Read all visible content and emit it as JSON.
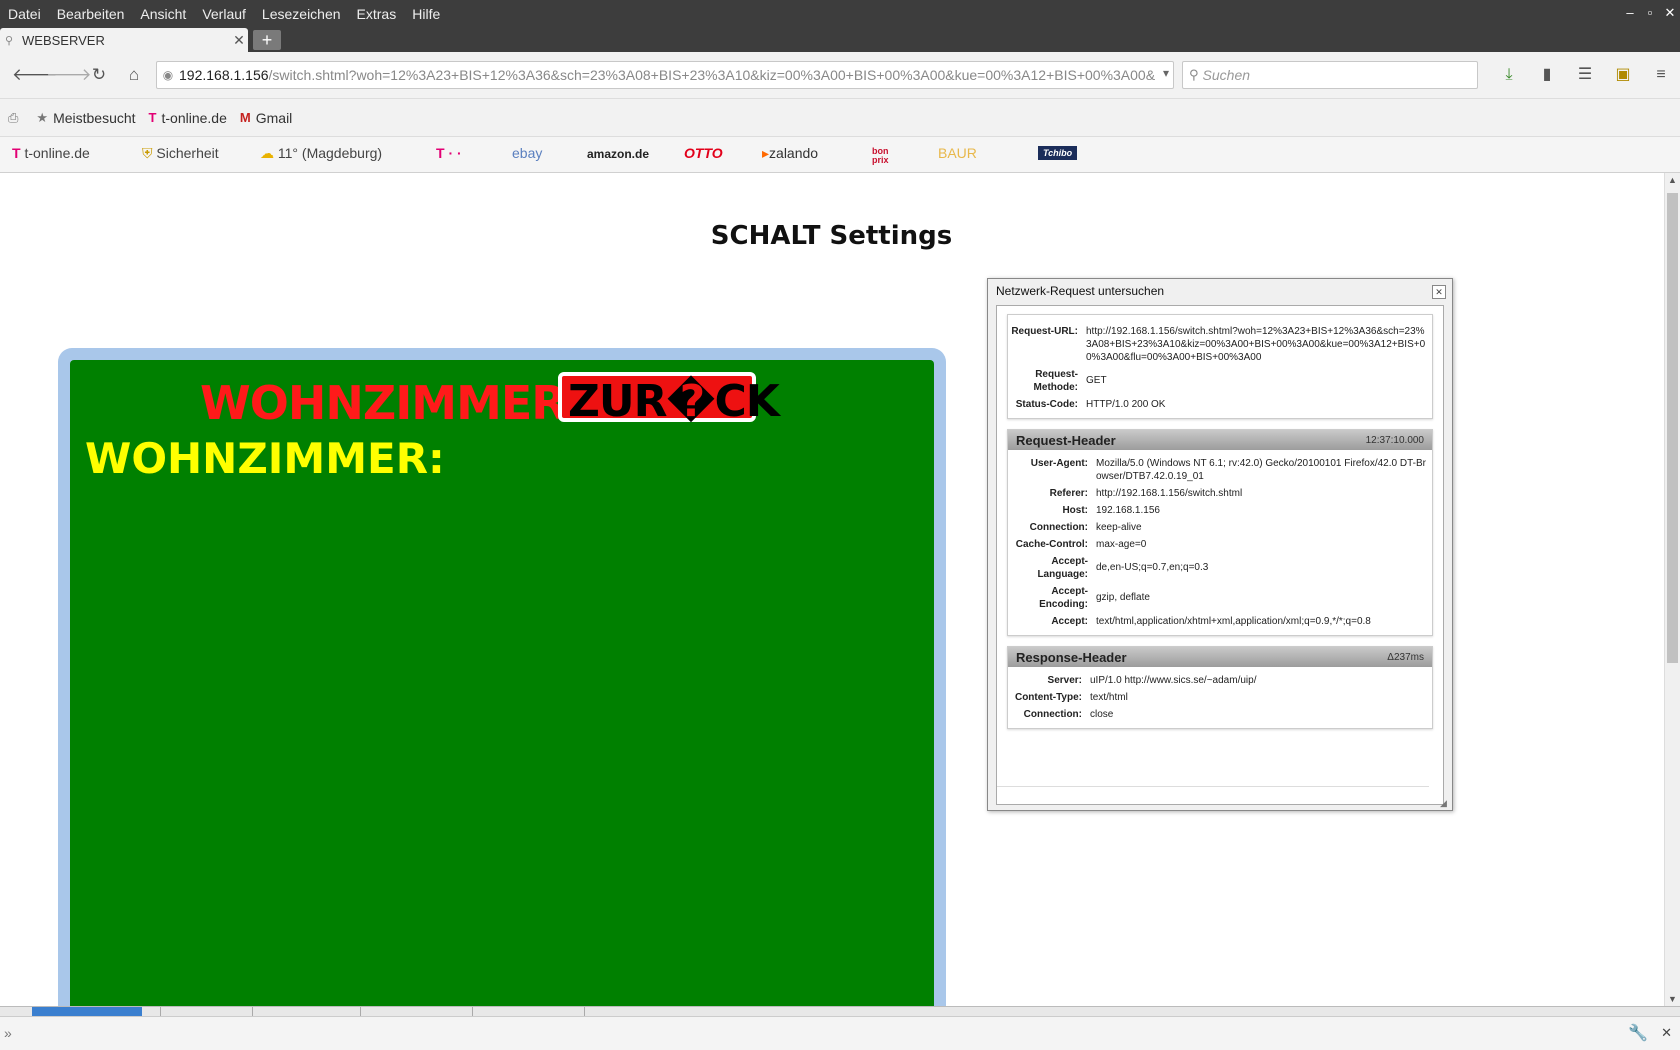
{
  "menu": [
    "Datei",
    "Bearbeiten",
    "Ansicht",
    "Verlauf",
    "Lesezeichen",
    "Extras",
    "Hilfe"
  ],
  "window_controls": {
    "minimize": "–",
    "maximize": "▫",
    "close": "✕"
  },
  "tab": {
    "title": "WEBSERVER",
    "close": "✕",
    "new_tab": "+"
  },
  "nav": {
    "back": "🡐",
    "forward": "🡒",
    "reload": "↻",
    "home": "⌂",
    "url_host": "192.168.1.156",
    "url_path": "/switch.shtml?woh=12%3A23+BIS+12%3A36&sch=23%3A08+BIS+23%3A10&kiz=00%3A00+BIS+00%3A00&kue=00%3A12+BIS+00%3A00&",
    "url_dropdown": "▾",
    "search_placeholder": "Suchen"
  },
  "bookmarks": [
    {
      "icon": "print-icon",
      "glyph": "⎙",
      "label": ""
    },
    {
      "icon": "most-visited-icon",
      "glyph": "★",
      "label": "Meistbesucht"
    },
    {
      "icon": "t-online-icon",
      "glyph": "T",
      "label": "t-online.de"
    },
    {
      "icon": "gmail-icon",
      "glyph": "M",
      "label": "Gmail"
    }
  ],
  "t_toolbar": {
    "home": "t-online.de",
    "security": "Sicherheit",
    "weather": "11° (Magdeburg)",
    "telekom": "T · ·",
    "ebay": "ebay",
    "amazon": "amazon.de",
    "otto": "OTTO",
    "zalando": "zalando",
    "bonprix": "bon prix",
    "baur": "BAUR",
    "tchibo": "Tchibo"
  },
  "page": {
    "title": "SCHALT Settings",
    "room_header": "WOHNZIMMER",
    "back_button": "ZUR�CK",
    "room_label": "WOHNZIMMER:"
  },
  "inspector": {
    "title": "Netzwerk-Request untersuchen",
    "close": "✕",
    "general": [
      {
        "key": "Request-URL:",
        "value": "http://192.168.1.156/switch.shtml?woh=12%3A23+BIS+12%3A36&sch=23%3A08+BIS+23%3A10&kiz=00%3A00+BIS+00%3A00&kue=00%3A12+BIS+00%3A00&flu=00%3A00+BIS+00%3A00"
      },
      {
        "key": "Request-Methode:",
        "value": "GET"
      },
      {
        "key": "Status-Code:",
        "value": "HTTP/1.0 200 OK"
      }
    ],
    "request_header": {
      "title": "Request-Header",
      "meta": "12:37:10.000",
      "rows": [
        {
          "key": "User-Agent:",
          "value": "Mozilla/5.0 (Windows NT 6.1; rv:42.0) Gecko/20100101 Firefox/42.0 DT-Browser/DTB7.42.0.19_01"
        },
        {
          "key": "Referer:",
          "value": "http://192.168.1.156/switch.shtml"
        },
        {
          "key": "Host:",
          "value": "192.168.1.156"
        },
        {
          "key": "Connection:",
          "value": "keep-alive"
        },
        {
          "key": "Cache-Control:",
          "value": "max-age=0"
        },
        {
          "key": "Accept-Language:",
          "value": "de,en-US;q=0.7,en;q=0.3"
        },
        {
          "key": "Accept-Encoding:",
          "value": "gzip, deflate"
        },
        {
          "key": "Accept:",
          "value": "text/html,application/xhtml+xml,application/xml;q=0.9,*/*;q=0.8"
        }
      ]
    },
    "response_header": {
      "title": "Response-Header",
      "meta": "Δ237ms",
      "rows": [
        {
          "key": "Server:",
          "value": "uIP/1.0 http://www.sics.se/~adam/uip/"
        },
        {
          "key": "Content-Type:",
          "value": "text/html"
        },
        {
          "key": "Connection:",
          "value": "close"
        }
      ]
    }
  },
  "console": {
    "prompt": "»"
  },
  "colors": {
    "panel_border": "#a9c7ea",
    "panel_bg": "#008000",
    "room_red": "#ff1a1a",
    "room_yellow": "#ffff00",
    "button_red": "#ee1111"
  }
}
